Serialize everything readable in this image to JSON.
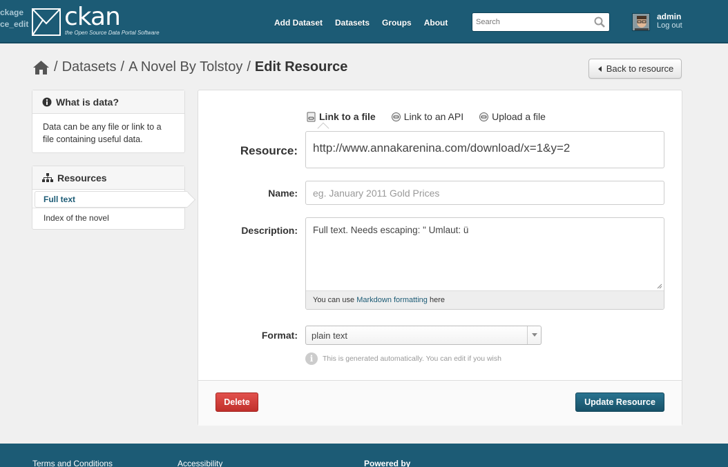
{
  "corner": {
    "line1": "ckage",
    "line2": "ce_edit"
  },
  "brand": {
    "name": "ckan",
    "tagline": "the Open Source Data Portal Software"
  },
  "nav": {
    "items": [
      "Add Dataset",
      "Datasets",
      "Groups",
      "About"
    ]
  },
  "search": {
    "placeholder": "Search"
  },
  "user": {
    "name": "admin",
    "logout": "Log out"
  },
  "breadcrumb": {
    "home_icon": "home-icon",
    "items": [
      "Datasets",
      "A Novel By Tolstoy"
    ],
    "active": "Edit Resource",
    "sep": "/"
  },
  "back_button": {
    "label": "Back to resource"
  },
  "sidebar": {
    "what": {
      "title": "What is data?",
      "text": "Data can be any file or link to a file containing useful data."
    },
    "resources": {
      "title": "Resources",
      "items": [
        "Full text",
        "Index of the novel"
      ]
    }
  },
  "form": {
    "tabs": [
      "Link to a file",
      "Link to an API",
      "Upload a file"
    ],
    "resource_label": "Resource:",
    "resource_value": "http://www.annakarenina.com/download/x=1&y=2",
    "name_label": "Name:",
    "name_placeholder": "eg. January 2011 Gold Prices",
    "description_label": "Description:",
    "description_value": "Full text. Needs escaping: \" Umlaut: ü",
    "markdown_help": {
      "before": "You can use ",
      "link": "Markdown formatting",
      "after": " here"
    },
    "format_label": "Format:",
    "format_value": "plain text",
    "format_hint": "This is generated automatically. You can edit if you wish",
    "delete_label": "Delete",
    "update_label": "Update Resource"
  },
  "footer": {
    "links": [
      "Terms and Conditions",
      "Accessibility",
      "Powered by"
    ]
  }
}
